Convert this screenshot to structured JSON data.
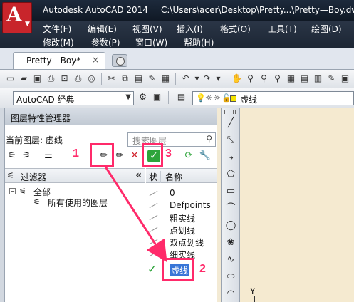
{
  "titlebar": {
    "logo_letter": "A",
    "app_name": "Autodesk AutoCAD 2014",
    "file_path": "C:\\Users\\acer\\Desktop\\Pretty...\\Pretty—Boy.dw"
  },
  "menubar": {
    "row1": [
      "文件(F)",
      "编辑(E)",
      "视图(V)",
      "插入(I)",
      "格式(O)",
      "工具(T)",
      "绘图(D)"
    ],
    "row2": [
      "修改(M)",
      "参数(P)",
      "窗口(W)",
      "帮助(H)"
    ]
  },
  "tabs": {
    "doc_tab": "Pretty—Boy*",
    "close": "×"
  },
  "workspace": {
    "value": "AutoCAD 经典"
  },
  "layer_combo": {
    "value": "虚线",
    "color_swatch": "#f5e400"
  },
  "layer_manager": {
    "title": "图层特性管理器",
    "current_layer": "当前图层: 虚线",
    "search_placeholder": "搜索图层",
    "filter_header": "过滤器",
    "collapse": "«",
    "tree_toggle": "−",
    "tree_root": "全部",
    "tree_child": "所有使用的图层",
    "list_header_status": "状",
    "list_header_name": "名称",
    "layers": [
      {
        "name": "0",
        "current": false
      },
      {
        "name": "Defpoints",
        "current": false
      },
      {
        "name": "粗实线",
        "current": false
      },
      {
        "name": "点划线",
        "current": false
      },
      {
        "name": "双点划线",
        "current": false
      },
      {
        "name": "细实线",
        "current": false
      },
      {
        "name": "虚线",
        "current": true
      }
    ]
  },
  "canvas": {
    "ucs_label": "Y"
  },
  "annotations": {
    "labels": [
      "1",
      "2",
      "3"
    ],
    "color": "#ff2a6a"
  },
  "icons": {
    "new_layer": "new-layer-icon",
    "new_vp_frozen": "new-vp-freeze-layer-icon",
    "delete_layer": "delete-layer-icon",
    "set_current": "set-current-icon",
    "refresh": "refresh-icon",
    "settings": "wrench-icon"
  }
}
